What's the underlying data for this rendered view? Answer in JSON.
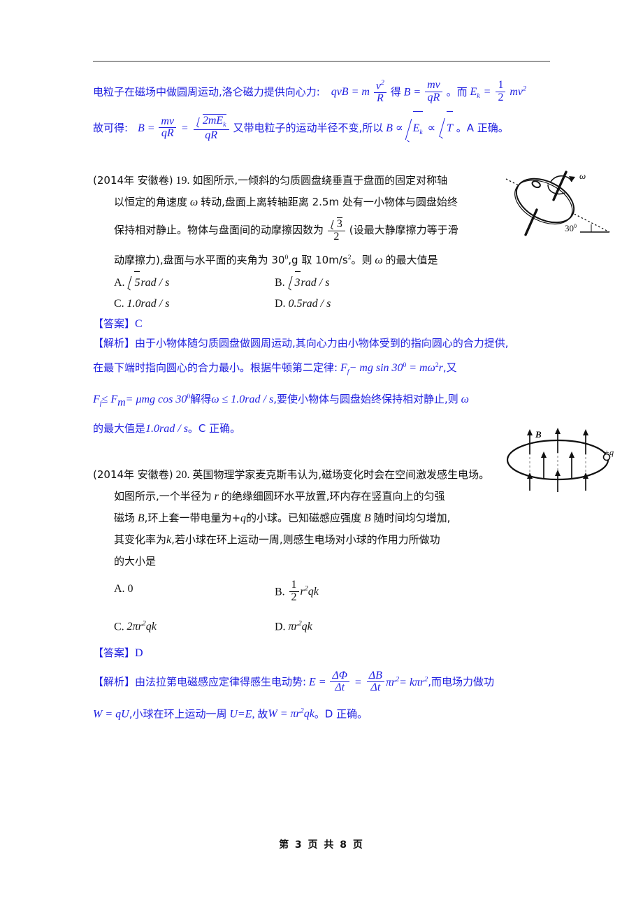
{
  "document": {
    "page_footer": "第 3 页 共 8 页",
    "page_number": "3",
    "total_pages": "8",
    "colors": {
      "answer_blue": "#2020e0",
      "body_black": "#111111",
      "header_rule": "#3a3a3a"
    }
  },
  "solution_prev": {
    "line1_pre": "电粒子在磁场中做圆周运动,洛仑磁力提供向心力:",
    "line1_f1_lhs": "qvB = m",
    "line1_f1_num": "v",
    "line1_f1_den": "R",
    "line1_mid1": "得",
    "line1_f2_lhs": "B =",
    "line1_f2_num": "mv",
    "line1_f2_den": "qR",
    "line1_mid2": "。而",
    "line1_f3_lhs": "E",
    "line1_f3_sub": "k",
    "line1_f3_eq": "=",
    "line1_f3_num": "1",
    "line1_f3_den": "2",
    "line1_f3_tail": "mv",
    "line2_pre": "故可得:",
    "line2_b": "B =",
    "line2_f1_num": "mv",
    "line2_f1_den": "qR",
    "line2_eq": "=",
    "line2_f2_num_radicand": "2mE",
    "line2_f2_num_sub": "k",
    "line2_f2_den": "qR",
    "line2_mid": "又带电粒子的运动半径不变,所以",
    "line2_prop1": "B ∝",
    "line2_sqrt1": "E",
    "line2_sqrt1_sub": "k",
    "line2_prop2": "∝",
    "line2_sqrt2": "T",
    "line2_tail": "。A 正确。"
  },
  "question19": {
    "source": "(2014年 安徽卷)",
    "number": "19.",
    "stem_line1": "如图所示,一倾斜的匀质圆盘绕垂直于盘面的固定对称轴",
    "stem_line2_a": "以恒定的角速度",
    "stem_line2_omega": "ω",
    "stem_line2_b": "转动,盘面上离转轴距离 2.5m 处有一小物体与圆盘始终",
    "stem_line3_a": "保持相对静止。物体与盘面间的动摩擦因数为",
    "stem_line3_frac_num_radicand": "3",
    "stem_line3_frac_den": "2",
    "stem_line3_b": "(设最大静摩擦力等于滑",
    "stem_line4_a": "动摩擦力),盘面与水平面的夹角为 30",
    "stem_line4_sup": "0",
    "stem_line4_b": ",g 取 10m/s",
    "stem_line4_sup2": "2",
    "stem_line4_c": "。则",
    "stem_line4_omega": "ω",
    "stem_line4_d": "的最大值是",
    "choices": [
      {
        "label": "A.",
        "sqrt": "5",
        "text": "rad / s"
      },
      {
        "label": "B.",
        "sqrt": "3",
        "text": "rad / s"
      },
      {
        "label": "C.",
        "plain": "1.0",
        "text": "rad / s"
      },
      {
        "label": "D.",
        "plain": "0.5",
        "text": "rad / s"
      }
    ],
    "answer_label": "【答案】",
    "answer_value": "C",
    "analysis_label": "【解析】",
    "analysis_line1": "由于小物体随匀质圆盘做圆周运动,其向心力由小物体受到的指向圆心的合力提供,",
    "analysis_line2_a": "在最下端时指向圆心的合力最小。根据牛顿第二定律:",
    "analysis_line2_f": "F",
    "analysis_line2_f_sub": "f",
    "analysis_line2_eq": "− mg sin 30",
    "analysis_line2_sup": "0",
    "analysis_line2_rhs": "= mω",
    "analysis_line2_rhs_sup": "2",
    "analysis_line2_r": "r",
    "analysis_line2_tail": ",又",
    "analysis_line3_a": "F",
    "analysis_line3_a_sub": "f",
    "analysis_line3_le": "≤ F",
    "analysis_line3_m_sub": "m",
    "analysis_line3_b": "= μmg cos 30",
    "analysis_line3_sup": "0",
    "analysis_line3_c": "解得",
    "analysis_line3_omega": "ω ≤ 1.0rad / s",
    "analysis_line3_d": ",要使小物体与圆盘始终保持相对静止,则",
    "analysis_line3_omega2": "ω",
    "analysis_line4_a": "的最大值是",
    "analysis_line4_val": "1.0rad / s",
    "analysis_line4_b": "。C 正确。"
  },
  "question20": {
    "source": "(2014年 安徽卷)",
    "number": "20.",
    "stem_line1": "英国物理学家麦克斯韦认为,磁场变化时会在空间激发感生电场。",
    "stem_line2_a": "如图所示,一个半径为",
    "stem_line2_r": "r",
    "stem_line2_b": "的绝缘细圆环水平放置,环内存在竖直向上的匀强",
    "stem_line3_a": "磁场",
    "stem_line3_B": "B",
    "stem_line3_b": ",环上套一带电量为+",
    "stem_line3_q": "q",
    "stem_line3_c": "的小球。已知磁感应强度",
    "stem_line3_B2": "B",
    "stem_line3_d": "随时间均匀增加,",
    "stem_line4_a": "其变化率为",
    "stem_line4_k": "k",
    "stem_line4_b": ",若小球在环上运动一周,则感生电场对小球的作用力所做功",
    "stem_line5": "的大小是",
    "choices": [
      {
        "label": "A.",
        "value": "0"
      },
      {
        "label": "B.",
        "frac_num": "1",
        "frac_den": "2",
        "tail_r": "r",
        "tail_sup": "2",
        "tail": "qk"
      },
      {
        "label": "C.",
        "coef": "2π",
        "tail_r": "r",
        "tail_sup": "2",
        "tail": "qk"
      },
      {
        "label": "D.",
        "coef": "π",
        "tail_r": "r",
        "tail_sup": "2",
        "tail": "qk"
      }
    ],
    "answer_label": "【答案】",
    "answer_value": "D",
    "analysis_label": "【解析】",
    "analysis_line1_a": "由法拉第电磁感应定律得感生电动势:",
    "analysis_line1_E": "E =",
    "analysis_line1_f1_num": "ΔΦ",
    "analysis_line1_f1_den": "Δt",
    "analysis_line1_eq": "=",
    "analysis_line1_f2_num": "ΔB",
    "analysis_line1_f2_den": "Δt",
    "analysis_line1_pir": "πr",
    "analysis_line1_pir_sup": "2",
    "analysis_line1_eq2": "= kπr",
    "analysis_line1_eq2_sup": "2",
    "analysis_line1_b": ",而电场力做功",
    "analysis_line2_W": "W = qU",
    "analysis_line2_a": ",小球在环上运动一周",
    "analysis_line2_UE": "U=E,",
    "analysis_line2_b": "故",
    "analysis_line2_W2": "W = πr",
    "analysis_line2_W2_sup": "2",
    "analysis_line2_W2_tail": "qk",
    "analysis_line2_c": "。D 正确。"
  },
  "figure19": {
    "name": "tilted-rotating-disk",
    "omega_label": "ω",
    "angle_label": "30",
    "angle_sup": "0"
  },
  "figure20": {
    "name": "charged-ring-in-magnetic-field",
    "field_label": "B",
    "charge_label": "+q"
  }
}
